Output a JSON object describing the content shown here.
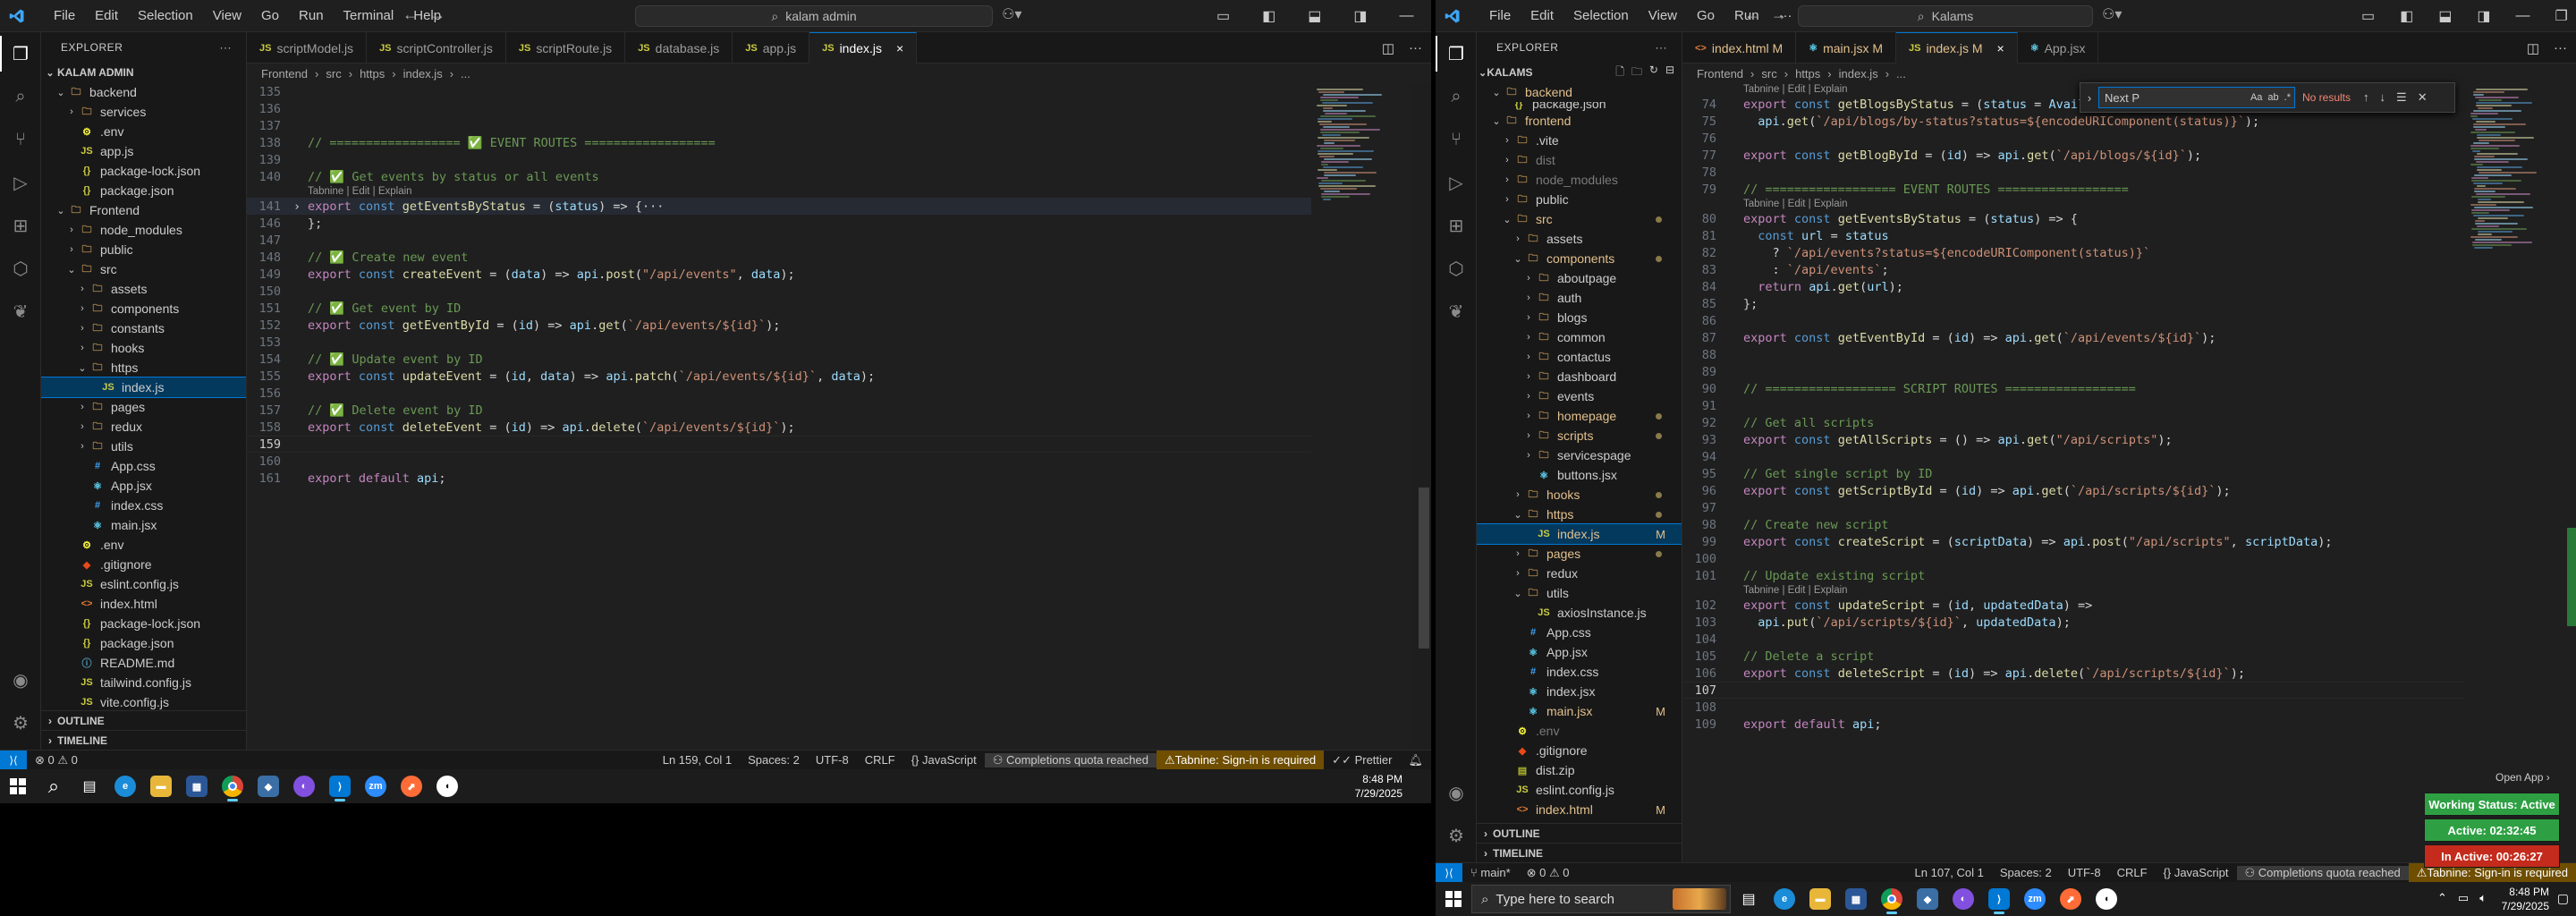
{
  "menus": [
    "File",
    "Edit",
    "Selection",
    "View",
    "Go",
    "Run",
    "Terminal",
    "Help"
  ],
  "menus2": [
    "File",
    "Edit",
    "Selection",
    "View",
    "Go",
    "Run"
  ],
  "left": {
    "search": "kalam admin",
    "tabs": [
      {
        "label": "scriptModel.js",
        "active": false
      },
      {
        "label": "scriptController.js",
        "active": false
      },
      {
        "label": "scriptRoute.js",
        "active": false
      },
      {
        "label": "database.js",
        "active": false
      },
      {
        "label": "app.js",
        "active": false
      },
      {
        "label": "index.js",
        "active": true,
        "close": "×"
      }
    ],
    "explorer_title": "EXPLORER",
    "root": "KALAM ADMIN",
    "breadcrumb": [
      "Frontend",
      "src",
      "https",
      "index.js",
      "..."
    ],
    "tree": [
      {
        "label": "backend",
        "depth": 1,
        "type": "folder",
        "open": true
      },
      {
        "label": "services",
        "depth": 2,
        "type": "folder",
        "open": false
      },
      {
        "label": ".env",
        "depth": 2,
        "type": "env"
      },
      {
        "label": "app.js",
        "depth": 2,
        "type": "js"
      },
      {
        "label": "package-lock.json",
        "depth": 2,
        "type": "json"
      },
      {
        "label": "package.json",
        "depth": 2,
        "type": "json"
      },
      {
        "label": "Frontend",
        "depth": 1,
        "type": "folder",
        "open": true
      },
      {
        "label": "node_modules",
        "depth": 2,
        "type": "folder",
        "open": false
      },
      {
        "label": "public",
        "depth": 2,
        "type": "folder",
        "open": false
      },
      {
        "label": "src",
        "depth": 2,
        "type": "folder",
        "open": true
      },
      {
        "label": "assets",
        "depth": 3,
        "type": "folder",
        "open": false
      },
      {
        "label": "components",
        "depth": 3,
        "type": "folder",
        "open": false
      },
      {
        "label": "constants",
        "depth": 3,
        "type": "folder",
        "open": false
      },
      {
        "label": "hooks",
        "depth": 3,
        "type": "folder",
        "open": false
      },
      {
        "label": "https",
        "depth": 3,
        "type": "folder",
        "open": true
      },
      {
        "label": "index.js",
        "depth": 4,
        "type": "js",
        "selected": true
      },
      {
        "label": "pages",
        "depth": 3,
        "type": "folder",
        "open": false
      },
      {
        "label": "redux",
        "depth": 3,
        "type": "folder",
        "open": false
      },
      {
        "label": "utils",
        "depth": 3,
        "type": "folder",
        "open": false
      },
      {
        "label": "App.css",
        "depth": 3,
        "type": "css"
      },
      {
        "label": "App.jsx",
        "depth": 3,
        "type": "jsx"
      },
      {
        "label": "index.css",
        "depth": 3,
        "type": "css"
      },
      {
        "label": "main.jsx",
        "depth": 3,
        "type": "jsx"
      },
      {
        "label": ".env",
        "depth": 2,
        "type": "env"
      },
      {
        "label": ".gitignore",
        "depth": 2,
        "type": "git"
      },
      {
        "label": "eslint.config.js",
        "depth": 2,
        "type": "js"
      },
      {
        "label": "index.html",
        "depth": 2,
        "type": "html"
      },
      {
        "label": "package-lock.json",
        "depth": 2,
        "type": "json"
      },
      {
        "label": "package.json",
        "depth": 2,
        "type": "json"
      },
      {
        "label": "README.md",
        "depth": 2,
        "type": "md"
      },
      {
        "label": "tailwind.config.js",
        "depth": 2,
        "type": "js"
      },
      {
        "label": "vite.config.js",
        "depth": 2,
        "type": "js"
      }
    ],
    "outline": "OUTLINE",
    "timeline": "TIMELINE",
    "code": [
      {
        "n": "135",
        "t": ""
      },
      {
        "n": "136",
        "t": ""
      },
      {
        "n": "137",
        "t": ""
      },
      {
        "n": "138",
        "t": "// ================== ✅ EVENT ROUTES ==================",
        "cls": "c"
      },
      {
        "n": "139",
        "t": ""
      },
      {
        "n": "140",
        "t": "// ✅ Get events by status or all events",
        "cls": "c"
      },
      {
        "lens": "Tabnine | Edit | Explain"
      },
      {
        "n": "141",
        "t": "export const getEventsByStatus = (status) => {···",
        "cls": "js",
        "fold": true,
        "hl": true
      },
      {
        "n": "146",
        "t": "};",
        "cls": "p"
      },
      {
        "n": "147",
        "t": ""
      },
      {
        "n": "148",
        "t": "// ✅ Create new event",
        "cls": "c"
      },
      {
        "n": "149",
        "t": "export const createEvent = (data) => api.post(\"/api/events\", data);",
        "cls": "js"
      },
      {
        "n": "150",
        "t": ""
      },
      {
        "n": "151",
        "t": "// ✅ Get event by ID",
        "cls": "c"
      },
      {
        "n": "152",
        "t": "export const getEventById = (id) => api.get(`/api/events/${id}`);",
        "cls": "js"
      },
      {
        "n": "153",
        "t": ""
      },
      {
        "n": "154",
        "t": "// ✅ Update event by ID",
        "cls": "c"
      },
      {
        "n": "155",
        "t": "export const updateEvent = (id, data) => api.patch(`/api/events/${id}`, data);",
        "cls": "js"
      },
      {
        "n": "156",
        "t": ""
      },
      {
        "n": "157",
        "t": "// ✅ Delete event by ID",
        "cls": "c"
      },
      {
        "n": "158",
        "t": "export const deleteEvent = (id) => api.delete(`/api/events/${id}`);",
        "cls": "js"
      },
      {
        "n": "159",
        "t": "",
        "cur": true
      },
      {
        "n": "160",
        "t": ""
      },
      {
        "n": "161",
        "t": "export default api;",
        "cls": "js"
      }
    ],
    "status": {
      "errors": "⊗ 0 ⚠ 0",
      "position": "Ln 159, Col 1",
      "spaces": "Spaces: 2",
      "encoding": "UTF-8",
      "eol": "CRLF",
      "language": "JavaScript",
      "quota": "Completions quota reached",
      "tabnine": "Tabnine: Sign-in is required",
      "prettier": "Prettier"
    },
    "taskbar_time": "8:48 PM",
    "taskbar_date": "7/29/2025"
  },
  "right": {
    "search": "Kalams",
    "tabs": [
      {
        "label": "index.html M",
        "active": false
      },
      {
        "label": "main.jsx M",
        "active": false
      },
      {
        "label": "index.js M",
        "active": true,
        "close": "×"
      },
      {
        "label": "App.jsx",
        "active": false
      }
    ],
    "explorer_title": "EXPLORER",
    "root": "KALAMS",
    "breadcrumb": [
      "Frontend",
      "src",
      "https",
      "index.js",
      "..."
    ],
    "tree": [
      {
        "label": "backend",
        "depth": 1,
        "type": "folder",
        "open": true,
        "color": "#e2c08d"
      },
      {
        "label": "frontend",
        "depth": 1,
        "type": "folder",
        "open": true,
        "color": "#e2c08d"
      },
      {
        "label": ".vite",
        "depth": 2,
        "type": "folder",
        "open": false
      },
      {
        "label": "dist",
        "depth": 2,
        "type": "folder",
        "open": false,
        "dim": true
      },
      {
        "label": "node_modules",
        "depth": 2,
        "type": "folder",
        "open": false,
        "dim": true
      },
      {
        "label": "public",
        "depth": 2,
        "type": "folder",
        "open": false
      },
      {
        "label": "src",
        "depth": 2,
        "type": "folder",
        "open": true,
        "color": "#e2c08d",
        "dot": true
      },
      {
        "label": "assets",
        "depth": 3,
        "type": "folder",
        "open": false
      },
      {
        "label": "components",
        "depth": 3,
        "type": "folder",
        "open": true,
        "color": "#e2c08d",
        "dot": true
      },
      {
        "label": "aboutpage",
        "depth": 4,
        "type": "folder",
        "open": false
      },
      {
        "label": "auth",
        "depth": 4,
        "type": "folder",
        "open": false
      },
      {
        "label": "blogs",
        "depth": 4,
        "type": "folder",
        "open": false
      },
      {
        "label": "common",
        "depth": 4,
        "type": "folder",
        "open": false
      },
      {
        "label": "contactus",
        "depth": 4,
        "type": "folder",
        "open": false
      },
      {
        "label": "dashboard",
        "depth": 4,
        "type": "folder",
        "open": false
      },
      {
        "label": "events",
        "depth": 4,
        "type": "folder",
        "open": false
      },
      {
        "label": "homepage",
        "depth": 4,
        "type": "folder",
        "open": false,
        "color": "#e2c08d",
        "dot": true
      },
      {
        "label": "scripts",
        "depth": 4,
        "type": "folder",
        "open": false,
        "color": "#e2c08d",
        "dot": true
      },
      {
        "label": "servicespage",
        "depth": 4,
        "type": "folder",
        "open": false
      },
      {
        "label": "buttons.jsx",
        "depth": 4,
        "type": "jsx"
      },
      {
        "label": "hooks",
        "depth": 3,
        "type": "folder",
        "open": false,
        "color": "#e2c08d",
        "dot": true
      },
      {
        "label": "https",
        "depth": 3,
        "type": "folder",
        "open": true,
        "color": "#e2c08d",
        "dot": true
      },
      {
        "label": "index.js",
        "depth": 4,
        "type": "js",
        "selected": true,
        "badge": "M",
        "color": "#e2c08d"
      },
      {
        "label": "pages",
        "depth": 3,
        "type": "folder",
        "open": false,
        "color": "#e2c08d",
        "dot": true
      },
      {
        "label": "redux",
        "depth": 3,
        "type": "folder",
        "open": false
      },
      {
        "label": "utils",
        "depth": 3,
        "type": "folder",
        "open": true
      },
      {
        "label": "axiosInstance.js",
        "depth": 4,
        "type": "js"
      },
      {
        "label": "App.css",
        "depth": 3,
        "type": "css"
      },
      {
        "label": "App.jsx",
        "depth": 3,
        "type": "jsx"
      },
      {
        "label": "index.css",
        "depth": 3,
        "type": "css"
      },
      {
        "label": "index.jsx",
        "depth": 3,
        "type": "jsx"
      },
      {
        "label": "main.jsx",
        "depth": 3,
        "type": "jsx",
        "badge": "M",
        "color": "#e2c08d"
      },
      {
        "label": ".env",
        "depth": 2,
        "type": "env",
        "dim": true
      },
      {
        "label": ".gitignore",
        "depth": 2,
        "type": "git"
      },
      {
        "label": "dist.zip",
        "depth": 2,
        "type": "zip"
      },
      {
        "label": "eslint.config.js",
        "depth": 2,
        "type": "js"
      },
      {
        "label": "index.html",
        "depth": 2,
        "type": "html",
        "badge": "M",
        "color": "#e2c08d"
      }
    ],
    "backend_child": "package.json",
    "outline": "OUTLINE",
    "timeline": "TIMELINE",
    "find": {
      "value": "Next P",
      "case": "Aa",
      "word": "ab",
      "regex": ".*",
      "results": "No results"
    },
    "code": [
      {
        "lens": "Tabnine | Edit | Explain"
      },
      {
        "n": "74",
        "t": "export const getBlogsByStatus = (status = \"Avail",
        "cls": "js"
      },
      {
        "n": "75",
        "t": "  api.get(`/api/blogs/by-status?status=${encodeURIComponent(status)}`);",
        "cls": "js"
      },
      {
        "n": "76",
        "t": ""
      },
      {
        "n": "77",
        "t": "export const getBlogById = (id) => api.get(`/api/blogs/${id}`);",
        "cls": "js"
      },
      {
        "n": "78",
        "t": ""
      },
      {
        "n": "79",
        "t": "// ================== EVENT ROUTES ==================",
        "cls": "c"
      },
      {
        "lens": "Tabnine | Edit | Explain"
      },
      {
        "n": "80",
        "t": "export const getEventsByStatus = (status) => {",
        "cls": "js"
      },
      {
        "n": "81",
        "t": "  const url = status",
        "cls": "js"
      },
      {
        "n": "82",
        "t": "    ? `/api/events?status=${encodeURIComponent(status)}`",
        "cls": "js"
      },
      {
        "n": "83",
        "t": "    : `/api/events`;",
        "cls": "js"
      },
      {
        "n": "84",
        "t": "  return api.get(url);",
        "cls": "js"
      },
      {
        "n": "85",
        "t": "};",
        "cls": "p"
      },
      {
        "n": "86",
        "t": ""
      },
      {
        "n": "87",
        "t": "export const getEventById = (id) => api.get(`/api/events/${id}`);",
        "cls": "js"
      },
      {
        "n": "88",
        "t": ""
      },
      {
        "n": "89",
        "t": ""
      },
      {
        "n": "90",
        "t": "// ================== SCRIPT ROUTES ==================",
        "cls": "c"
      },
      {
        "n": "91",
        "t": ""
      },
      {
        "n": "92",
        "t": "// Get all scripts",
        "cls": "c"
      },
      {
        "n": "93",
        "t": "export const getAllScripts = () => api.get(\"/api/scripts\");",
        "cls": "js"
      },
      {
        "n": "94",
        "t": ""
      },
      {
        "n": "95",
        "t": "// Get single script by ID",
        "cls": "c"
      },
      {
        "n": "96",
        "t": "export const getScriptById = (id) => api.get(`/api/scripts/${id}`);",
        "cls": "js"
      },
      {
        "n": "97",
        "t": ""
      },
      {
        "n": "98",
        "t": "// Create new script",
        "cls": "c"
      },
      {
        "n": "99",
        "t": "export const createScript = (scriptData) => api.post(\"/api/scripts\", scriptData);",
        "cls": "js"
      },
      {
        "n": "100",
        "t": ""
      },
      {
        "n": "101",
        "t": "// Update existing script",
        "cls": "c"
      },
      {
        "lens": "Tabnine | Edit | Explain"
      },
      {
        "n": "102",
        "t": "export const updateScript = (id, updatedData) =>",
        "cls": "js"
      },
      {
        "n": "103",
        "t": "  api.put(`/api/scripts/${id}`, updatedData);",
        "cls": "js"
      },
      {
        "n": "104",
        "t": ""
      },
      {
        "n": "105",
        "t": "// Delete a script",
        "cls": "c"
      },
      {
        "n": "106",
        "t": "export const deleteScript = (id) => api.delete(`/api/scripts/${id}`);",
        "cls": "js"
      },
      {
        "n": "107",
        "t": "",
        "cur": true
      },
      {
        "n": "108",
        "t": ""
      },
      {
        "n": "109",
        "t": "export default api;",
        "cls": "js"
      }
    ],
    "status": {
      "branch": "main*",
      "errors": "⊗ 0 ⚠ 0",
      "position": "Ln 107, Col 1",
      "spaces": "Spaces: 2",
      "encoding": "UTF-8",
      "eol": "CRLF",
      "language": "JavaScript",
      "quota": "Completions quota reached",
      "tabnine": "Tabnine: Sign-in is required",
      "prettier": "Prettier"
    },
    "open_app": "Open App ›",
    "widgets": {
      "working": "Working Status: Active",
      "active": "Active: 02:32:45",
      "inactive": "In Active: 00:26:27"
    },
    "taskbar_search": "Type here to search",
    "taskbar_time": "8:48 PM",
    "taskbar_date": "7/29/2025"
  },
  "colors": {
    "accent": "#0078d4",
    "modified": "#e2c08d",
    "warn": "#6f4e00",
    "widget_green": "#2ea043",
    "widget_red": "#c42b1c"
  }
}
